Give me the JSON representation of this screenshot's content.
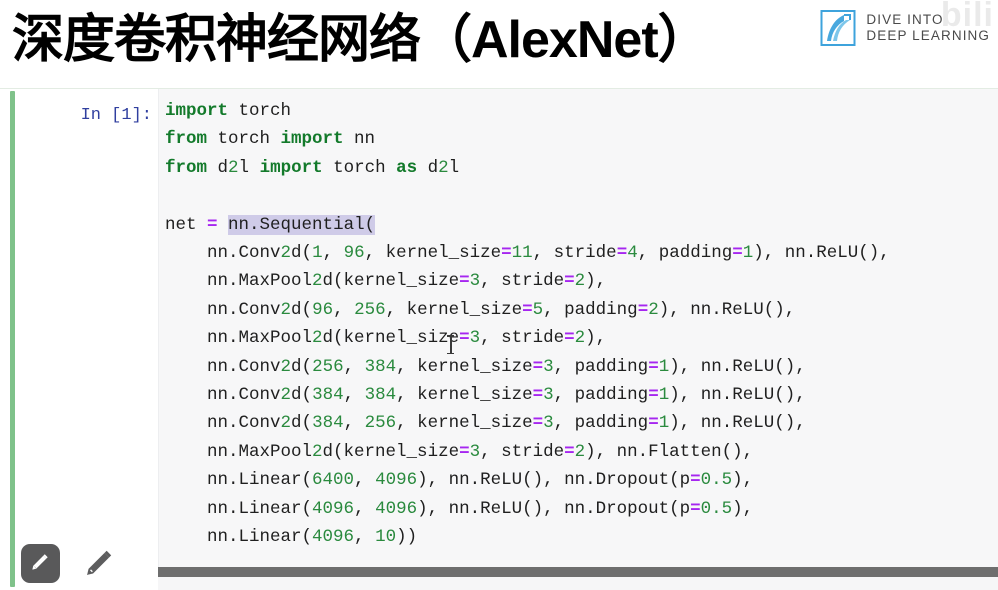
{
  "header": {
    "title": "深度卷积神经网络（AlexNet）",
    "watermark_text": "bili",
    "logo": {
      "icon": "open-book-icon",
      "line1": "DIVE INTO",
      "line2": "DEEP LEARNING",
      "color": "#3ea3dc"
    }
  },
  "notebook": {
    "cell_selected_color": "#7fc28a",
    "prompt": "In [1]:",
    "code_lines": [
      "import torch",
      "from torch import nn",
      "from d2l import torch as d2l",
      "",
      "net = nn.Sequential(",
      "    nn.Conv2d(1, 96, kernel_size=11, stride=4, padding=1), nn.ReLU(),",
      "    nn.MaxPool2d(kernel_size=3, stride=2),",
      "    nn.Conv2d(96, 256, kernel_size=5, padding=2), nn.ReLU(),",
      "    nn.MaxPool2d(kernel_size=3, stride=2),",
      "    nn.Conv2d(256, 384, kernel_size=3, padding=1), nn.ReLU(),",
      "    nn.Conv2d(384, 384, kernel_size=3, padding=1), nn.ReLU(),",
      "    nn.Conv2d(384, 256, kernel_size=3, padding=1), nn.ReLU(),",
      "    nn.MaxPool2d(kernel_size=3, stride=2), nn.Flatten(),",
      "    nn.Linear(6400, 4096), nn.ReLU(), nn.Dropout(p=0.5),",
      "    nn.Linear(4096, 4096), nn.ReLU(), nn.Dropout(p=0.5),",
      "    nn.Linear(4096, 10))"
    ],
    "selected_text": "nn.Sequential(",
    "syntax_colors": {
      "keyword": "#137a2b",
      "number": "#2a8a3e",
      "operator": "#a626f0",
      "selection": "#cfcbe8",
      "prompt": "#303f9f",
      "code_background": "#f7f7f8"
    },
    "scrollbar": {
      "orientation": "horizontal",
      "thumb_color": "#6e6e6e"
    }
  },
  "annotation_toolbar": {
    "tools": [
      {
        "name": "pen-tool-button",
        "icon": "pencil-icon",
        "active": true
      },
      {
        "name": "pen-tool-freehand",
        "icon": "pencil-icon",
        "active": false
      }
    ]
  }
}
